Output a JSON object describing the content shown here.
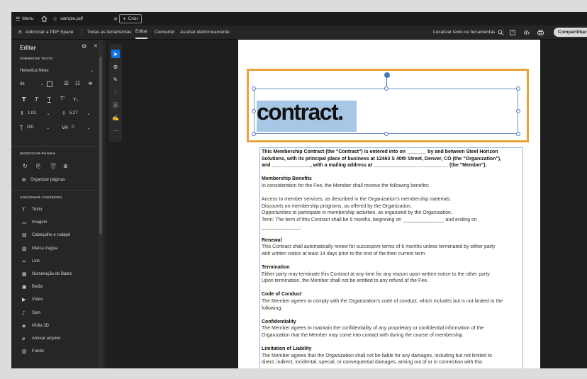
{
  "titlebar": {
    "menu": "Menu",
    "tab_title": "sample.pdf",
    "new_tab": "Criar"
  },
  "toolbar": {
    "add_space": "Adicionar a PDF Space",
    "all_tools": "Todas as ferramentas",
    "edit": "Editar",
    "convert": "Converter",
    "sign": "Assinar eletronicamente",
    "find": "Localizar texto ou ferramentas",
    "share": "Compartilhar"
  },
  "sidebar": {
    "title": "Editar",
    "format_section": "FORMATAR TEXTO",
    "font": "Helvetica Neue",
    "font_size": "36",
    "line_spacing": "1.03",
    "para_spacing": "5.27",
    "scale": "100",
    "char_spacing": "0",
    "modify_section": "MODIFICAR PÁGINA",
    "organize": "Organizar páginas",
    "add_section": "ADICIONAR CONTEÚDO",
    "items": [
      {
        "label": "Texto",
        "icon": "text-icon",
        "glyph": "T"
      },
      {
        "label": "Imagem",
        "icon": "image-icon",
        "glyph": "▭"
      },
      {
        "label": "Cabeçalho e rodapé",
        "icon": "header-footer-icon",
        "glyph": "▤"
      },
      {
        "label": "Marca d'água",
        "icon": "watermark-icon",
        "glyph": "▧"
      },
      {
        "label": "Link",
        "icon": "link-icon",
        "glyph": "∞"
      },
      {
        "label": "Numeração de Bates",
        "icon": "bates-icon",
        "glyph": "▦"
      },
      {
        "label": "Botão",
        "icon": "button-icon",
        "glyph": "▣"
      },
      {
        "label": "Vídeo",
        "icon": "video-icon",
        "glyph": "▶"
      },
      {
        "label": "Som",
        "icon": "sound-icon",
        "glyph": "♪"
      },
      {
        "label": "Mídia 3D",
        "icon": "media-3d-icon",
        "glyph": "◈"
      },
      {
        "label": "Anexar arquivo",
        "icon": "attach-icon",
        "glyph": "⌀"
      },
      {
        "label": "Fundo",
        "icon": "background-icon",
        "glyph": "▥"
      }
    ]
  },
  "doc": {
    "heading_word": "contract.",
    "lines": [
      {
        "t": "This Membership Contract (the \"Contract\") is entered into on _______ by and between Steel Horizon",
        "b": true
      },
      {
        "t": "Solutions, with its principal place of business at 12463 S 40th Street, Denver, CO (the \"Organization\"),",
        "b": true
      },
      {
        "t": "and ______________, with a mailing address at ___________________________ (the \"Member\").",
        "b": true
      },
      {
        "t": "",
        "b": false
      },
      {
        "t": "Membership Benefits",
        "b": true
      },
      {
        "t": "In consideration for the Fee, the Member shall receive the following benefits:",
        "b": false
      },
      {
        "t": "",
        "b": false
      },
      {
        "t": "Access to member services, as described in the Organization's membership materials.",
        "b": false
      },
      {
        "t": "Discounts on membership programs, as offered by the Organization.",
        "b": false
      },
      {
        "t": "Opportunities to participate in membership activities, as organized by the Organization.",
        "b": false
      },
      {
        "t": "Term: The term of this Contract shall be 6 months, beginning on _______________ and ending on",
        "b": false
      },
      {
        "t": "______________.",
        "b": false
      },
      {
        "t": "",
        "b": false
      },
      {
        "t": "Renewal",
        "b": true
      },
      {
        "t": "This Contract shall automatically renew for successive terms of 6 months unless terminated by either party",
        "b": false
      },
      {
        "t": "with written notice at least 14 days prior to the end of the then current term.",
        "b": false
      },
      {
        "t": "",
        "b": false
      },
      {
        "t": "Termination",
        "b": true
      },
      {
        "t": "Either party may terminate this Contract at any time for any reason upon written notice to the other party.",
        "b": false
      },
      {
        "t": "Upon termination, the Member shall not be entitled to any refund of the Fee.",
        "b": false
      },
      {
        "t": "",
        "b": false
      },
      {
        "t": "Code of Conduct",
        "b": true
      },
      {
        "t": "The Member agrees to comply with the Organization's code of conduct, which includes but is not limited to the",
        "b": false
      },
      {
        "t": "following:",
        "b": false
      },
      {
        "t": "",
        "b": false
      },
      {
        "t": "Confidentiality",
        "b": true
      },
      {
        "t": "The Member agrees to maintain the confidentiality of any proprietary or confidential information of the",
        "b": false
      },
      {
        "t": "Organization that the Member may come into contact with during the course of membership.",
        "b": false
      },
      {
        "t": "",
        "b": false
      },
      {
        "t": "Limitation of Liability",
        "b": true
      },
      {
        "t": "The Member agrees that the Organization shall not be liable for any damages, including but not limited to",
        "b": false
      },
      {
        "t": "direct, indirect, incidental, special, or consequential damages, arising out of or in connection with this",
        "b": false
      }
    ]
  }
}
